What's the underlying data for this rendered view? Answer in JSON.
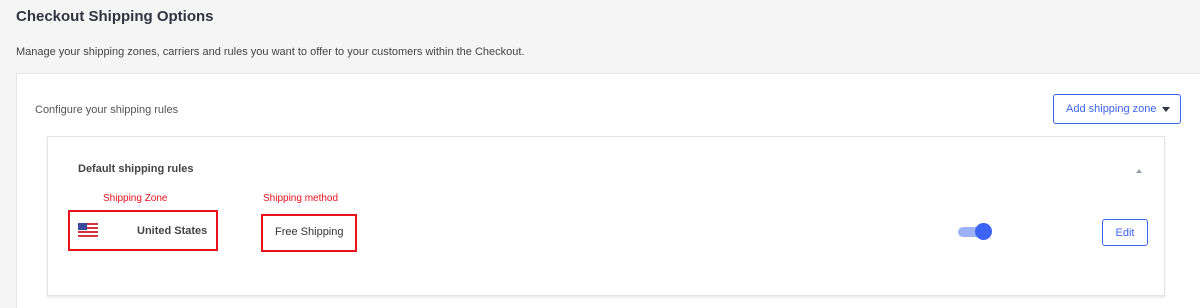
{
  "header": {
    "title": "Checkout Shipping Options",
    "description": "Manage your shipping zones, carriers and rules you want to offer to your customers within the Checkout."
  },
  "card": {
    "subtitle": "Configure your shipping rules",
    "add_zone_label": "Add shipping zone"
  },
  "rules": {
    "title": "Default shipping rules",
    "annotations": {
      "zone_label": "Shipping Zone",
      "method_label": "Shipping method"
    },
    "row": {
      "zone": "United States",
      "zone_icon": "us-flag-icon",
      "method": "Free Shipping",
      "enabled": true,
      "edit_label": "Edit"
    }
  },
  "colors": {
    "accent": "#3c64f4",
    "annotation_red": "#e8111c",
    "background": "#f5f5f5"
  }
}
